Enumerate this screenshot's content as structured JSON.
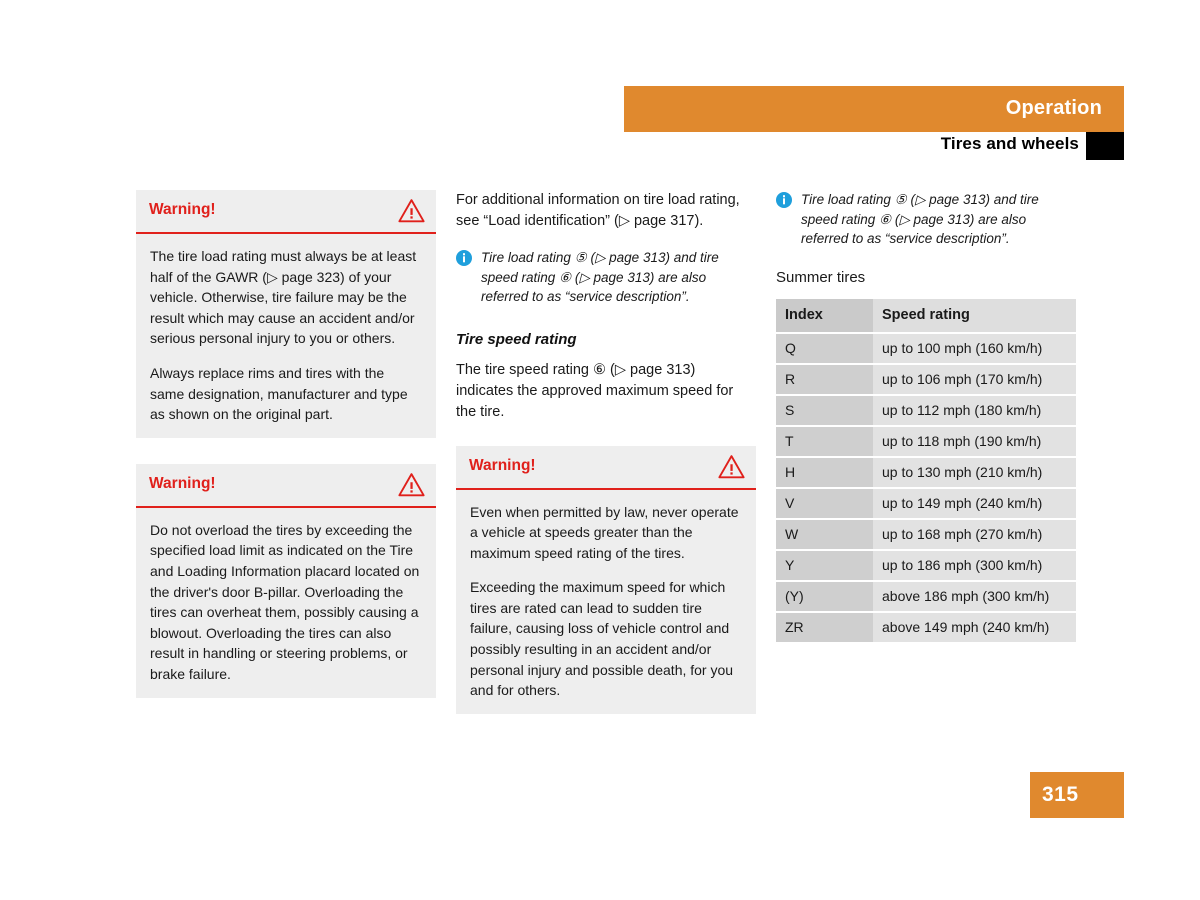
{
  "header": {
    "section_title": "Operation",
    "subsection_title": "Tires and wheels"
  },
  "footer": {
    "page_number": "315"
  },
  "left_column": {
    "warning_boxes": [
      {
        "title": "Warning!",
        "icon": "warning-triangle-icon",
        "paragraphs": [
          "The tire load rating must always be at least half of the GAWR (▷ page 323) of your vehicle. Otherwise, tire failure may be the result which may cause an accident and/or serious personal injury to you or others.",
          "Always replace rims and tires with the same designation, manufacturer and type as shown on the original part."
        ]
      },
      {
        "title": "Warning!",
        "icon": "warning-triangle-icon",
        "paragraphs": [
          "Do not overload the tires by exceeding the specified load limit as indicated on the Tire and Loading Information placard located on the driver's door B-pillar. Overloading the tires can overheat them, possibly causing a blowout. Overloading the tires can also result in handling or steering problems, or brake failure."
        ]
      }
    ]
  },
  "middle_column": {
    "intro_paragraph": "For additional information on tire load rating, see “Load identification” (▷ page 317).",
    "note": {
      "icon": "info-icon",
      "text": "Tire load rating ⑤ (▷ page 313) and tire speed rating ⑥ (▷ page 313) are also referred to as “service description”."
    },
    "heading": "Tire speed rating",
    "body_paragraph": "The tire speed rating ⑥ (▷ page 313) indicates the approved maximum speed for the tire.",
    "warning_box": {
      "title": "Warning!",
      "icon": "warning-triangle-icon",
      "paragraphs": [
        "Even when permitted by law, never operate a vehicle at speeds greater than the maximum speed rating of the tires.",
        "Exceeding the maximum speed for which tires are rated can lead to sudden tire failure, causing loss of vehicle control and possibly resulting in an accident and/or personal injury and possible death, for you and for others."
      ]
    }
  },
  "right_column": {
    "note": {
      "icon": "info-icon",
      "text": "Tire load rating ⑤ (▷ page 313) and tire speed rating ⑥ (▷ page 313) are also referred to as “service description”."
    },
    "table_heading": "Summer tires",
    "table": {
      "columns": [
        "Index",
        "Speed rating"
      ],
      "rows": [
        [
          "Q",
          "up to 100 mph (160 km/h)"
        ],
        [
          "R",
          "up to 106 mph (170 km/h)"
        ],
        [
          "S",
          "up to 112 mph (180 km/h)"
        ],
        [
          "T",
          "up to 118 mph (190 km/h)"
        ],
        [
          "H",
          "up to 130 mph (210 km/h)"
        ],
        [
          "V",
          "up to 149 mph (240 km/h)"
        ],
        [
          "W",
          "up to 168 mph (270 km/h)"
        ],
        [
          "Y",
          "up to 186 mph (300 km/h)"
        ],
        [
          "(Y)",
          "above 186 mph (300 km/h)"
        ],
        [
          "ZR",
          "above 149 mph (240 km/h)"
        ]
      ]
    }
  },
  "colors": {
    "accent_orange": "#e0892e",
    "warning_red": "#e0201b",
    "info_blue": "#1f9fdc",
    "box_gray": "#eeeeee",
    "table_index_gray": "#cfcfcf",
    "table_rate_gray": "#e2e2e2"
  }
}
